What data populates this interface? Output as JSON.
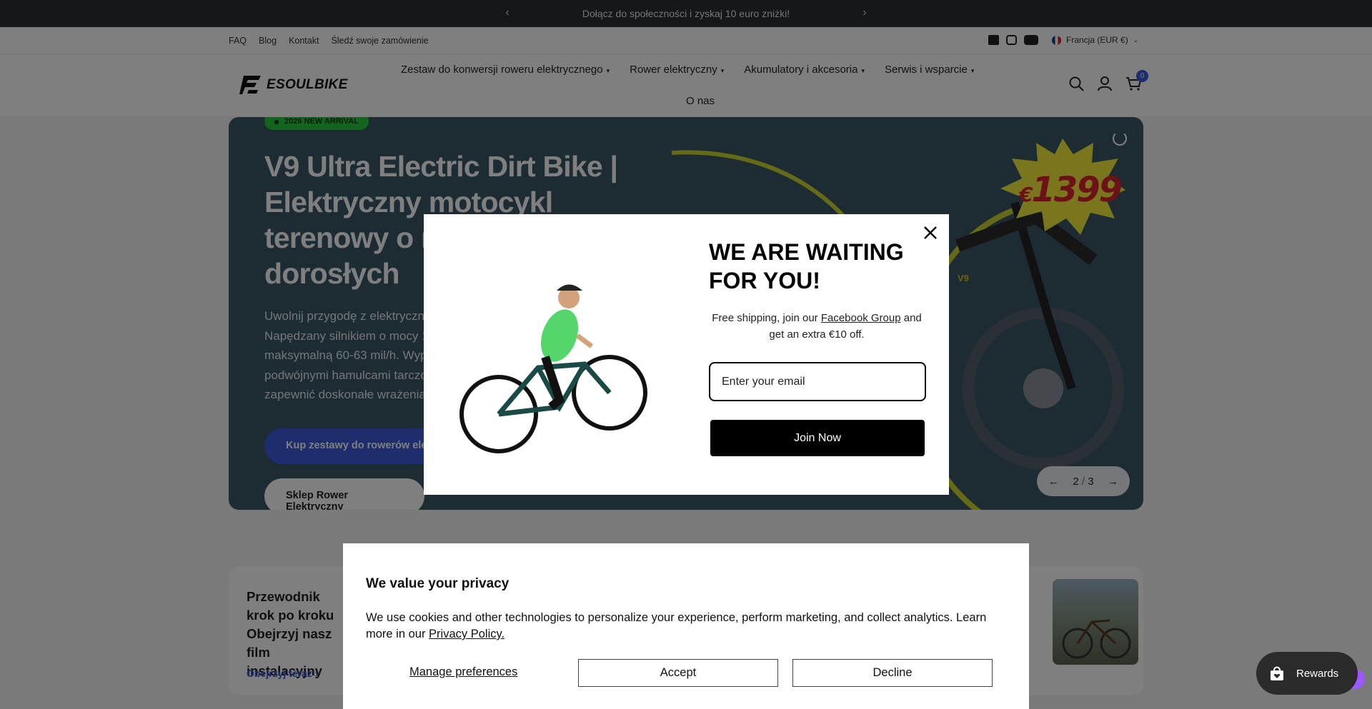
{
  "announcement": {
    "text": "Dołącz do społeczności i zyskaj 10 euro zniżki!"
  },
  "utility": {
    "links": [
      "FAQ",
      "Blog",
      "Kontakt",
      "Śledź swoje zamówienie"
    ],
    "currency": "Francja (EUR €)"
  },
  "brand": {
    "name": "ESOULBIKE"
  },
  "nav": {
    "items": [
      "Zestaw do konwersji roweru elektrycznego",
      "Rower elektryczny",
      "Akumulatory i akcesoria",
      "Serwis i wsparcie"
    ],
    "about": "O nas"
  },
  "cart": {
    "count": "0"
  },
  "hero": {
    "pill": "2026 NEW ARRIVAL",
    "title": "V9 Ultra Electric Dirt Bike | Elektryczny motocykl terenowy o mocy dla dorosłych",
    "description": "Uwolnij przygodę z elektrycznym motocyklem terenowym V9 Ultra. Napędzany silnikiem o mocy 12000 W, osiąga prędkość maksymalną 60-63 mil/h. Wyposażony w ramę z włókna węglowej, podwójnymi hamulcami tarczowymi i pełnym zawieszeniem, aby zapewnić doskonałe wrażenia.",
    "button_primary": "Kup zestawy do rowerów elektrycznych",
    "button_secondary": "Sklep Rower Elektryczny",
    "price_currency": "€",
    "price": "1399",
    "badge": "V9",
    "slide_current": "2",
    "slide_sep": "/",
    "slide_total": "3"
  },
  "card": {
    "title": "Przewodnik krok po kroku Obejrzyj nasz film instalacyjny",
    "link": "Obejrzyj teraz"
  },
  "popup": {
    "heading": "WE ARE WAITING FOR YOU!",
    "text_before": "Free shipping, join our",
    "link": "Facebook Group",
    "text_after": "and get an extra €10 off.",
    "email_placeholder": "Enter your email",
    "button": "Join Now"
  },
  "cookie": {
    "title": "We value your privacy",
    "text": "We use cookies and other technologies to personalize your experience, perform marketing, and collect analytics. Learn more in our",
    "policy_link": "Privacy Policy.",
    "manage": "Manage preferences",
    "accept": "Accept",
    "decline": "Decline"
  },
  "rewards": {
    "label": "Rewards"
  },
  "colors": {
    "accent": "#3b5bdb",
    "hero_bg": "#3a5766",
    "green_pill": "#27c93f",
    "price_red": "#d9222a"
  }
}
